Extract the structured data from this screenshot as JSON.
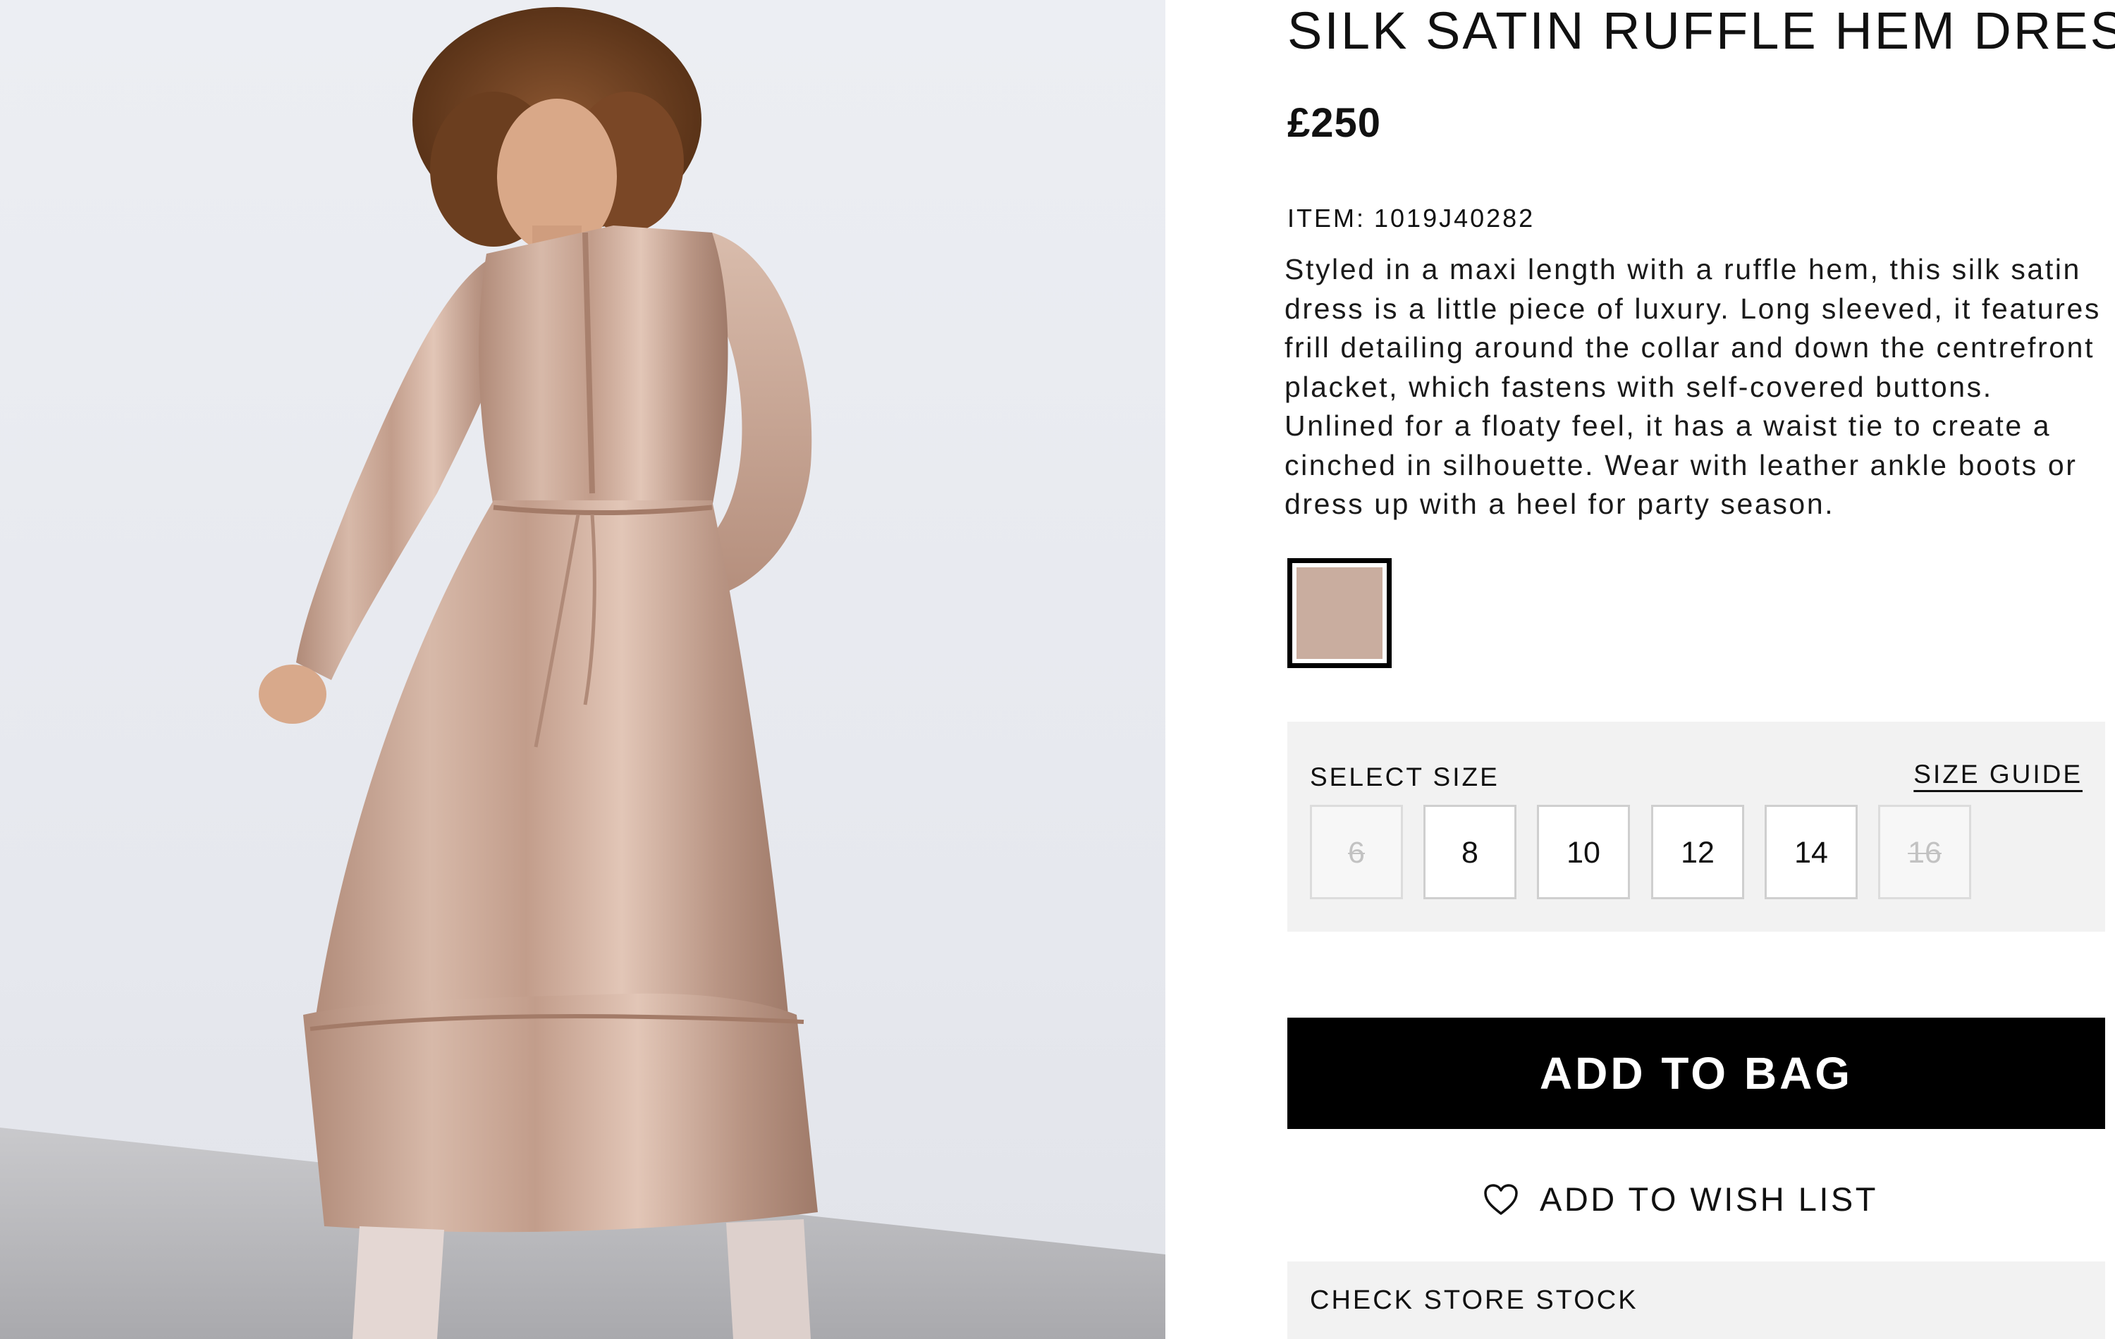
{
  "product": {
    "title": "SILK SATIN RUFFLE HEM DRESS",
    "price": "£250",
    "item_label": "ITEM:",
    "item_code": "1019J40282",
    "description": "Styled in a maxi length with a ruffle hem, this silk satin dress is a little piece of luxury. Long sleeved, it features frill detailing around the collar and down the centrefront placket, which fastens with self-covered buttons. Unlined for a floaty feel, it has a waist tie to create a cinched in silhouette. Wear with leather ankle boots or dress up with a heel for party season."
  },
  "colour_swatch": {
    "color": "#c9ad9f",
    "selected": true
  },
  "size_selector": {
    "label": "SELECT SIZE",
    "guide_label": "SIZE GUIDE",
    "sizes": [
      {
        "label": "6",
        "available": false
      },
      {
        "label": "8",
        "available": true
      },
      {
        "label": "10",
        "available": true
      },
      {
        "label": "12",
        "available": true
      },
      {
        "label": "14",
        "available": true
      },
      {
        "label": "16",
        "available": false
      }
    ]
  },
  "actions": {
    "add_to_bag": "ADD TO BAG",
    "wish_list": "ADD TO WISH LIST",
    "check_store_stock": "CHECK STORE STOCK"
  },
  "icons": {
    "wish_list": "heart-outline-icon"
  },
  "colors": {
    "primary_button": "#000000",
    "panel_background": "#f2f2f2"
  }
}
